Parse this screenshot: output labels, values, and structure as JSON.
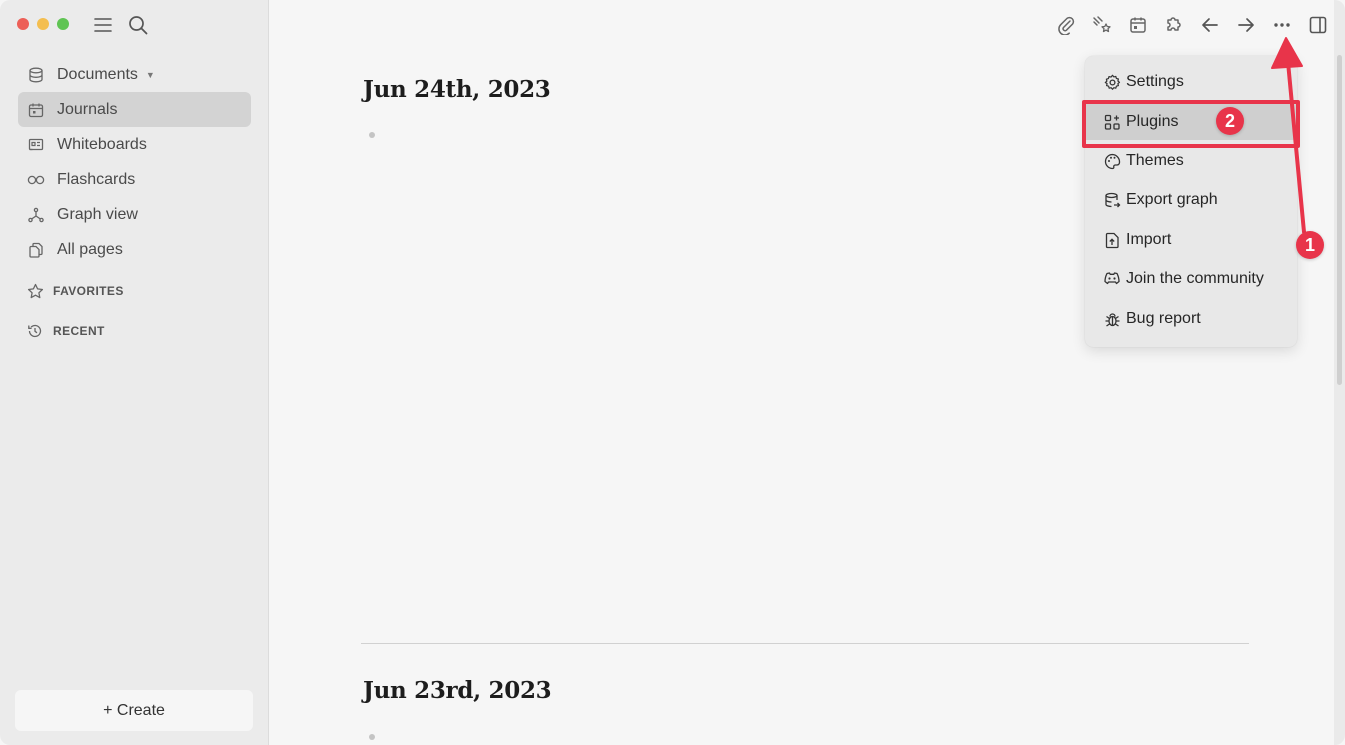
{
  "window": {
    "traffic_lights": [
      "close",
      "minimize",
      "maximize"
    ]
  },
  "sidebar": {
    "top_icons": [
      "menu-icon",
      "search-icon"
    ],
    "items": [
      {
        "label": "Documents",
        "icon": "database-icon",
        "has_dropdown": true,
        "active": false
      },
      {
        "label": "Journals",
        "icon": "calendar-icon",
        "active": true
      },
      {
        "label": "Whiteboards",
        "icon": "whiteboard-icon",
        "active": false
      },
      {
        "label": "Flashcards",
        "icon": "infinity-icon",
        "active": false
      },
      {
        "label": "Graph view",
        "icon": "graph-icon",
        "active": false
      },
      {
        "label": "All pages",
        "icon": "pages-icon",
        "active": false
      }
    ],
    "sections": [
      {
        "label": "FAVORITES",
        "icon": "star-icon"
      },
      {
        "label": "RECENT",
        "icon": "history-icon"
      }
    ],
    "create_label": "+ Create"
  },
  "toolbar": {
    "buttons": [
      "paperclip-icon",
      "sparkles-icon",
      "calendar-icon",
      "puzzle-icon",
      "arrow-left-icon",
      "arrow-right-icon",
      "more-icon",
      "sidebar-toggle-icon"
    ]
  },
  "journals": [
    {
      "title": "Jun 24th, 2023"
    },
    {
      "title": "Jun 23rd, 2023"
    }
  ],
  "menu": {
    "items": [
      {
        "label": "Settings",
        "icon": "gear-icon"
      },
      {
        "label": "Plugins",
        "icon": "plugins-icon",
        "highlighted": true
      },
      {
        "label": "Themes",
        "icon": "palette-icon"
      },
      {
        "label": "Export graph",
        "icon": "export-db-icon"
      },
      {
        "label": "Import",
        "icon": "import-file-icon"
      },
      {
        "label": "Join the community",
        "icon": "discord-icon"
      },
      {
        "label": "Bug report",
        "icon": "bug-icon"
      }
    ]
  },
  "annotations": {
    "badge_1": "1",
    "badge_2": "2",
    "color": "#e8344a"
  }
}
